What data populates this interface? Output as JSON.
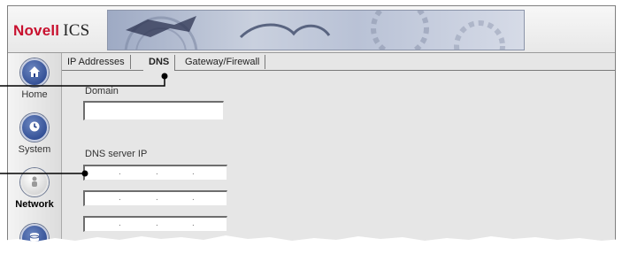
{
  "app": {
    "brand": "Novell",
    "product": "ICS"
  },
  "sidebar": {
    "items": [
      {
        "label": "Home",
        "icon": "house-icon",
        "active": false
      },
      {
        "label": "System",
        "icon": "clock-icon",
        "active": false
      },
      {
        "label": "Network",
        "icon": "network-icon",
        "active": true
      },
      {
        "label": "",
        "icon": "disk-icon",
        "active": false
      }
    ]
  },
  "tabs": [
    {
      "label": "IP Addresses",
      "active": false
    },
    {
      "label": "DNS",
      "active": true
    },
    {
      "label": "Gateway/Firewall",
      "active": false
    }
  ],
  "form": {
    "domain_label": "Domain",
    "domain_value": "",
    "dns_label": "DNS server IP",
    "ip_dots": "."
  },
  "colors": {
    "brand_red": "#c8102e",
    "icon_blue": "#1f3c86"
  }
}
